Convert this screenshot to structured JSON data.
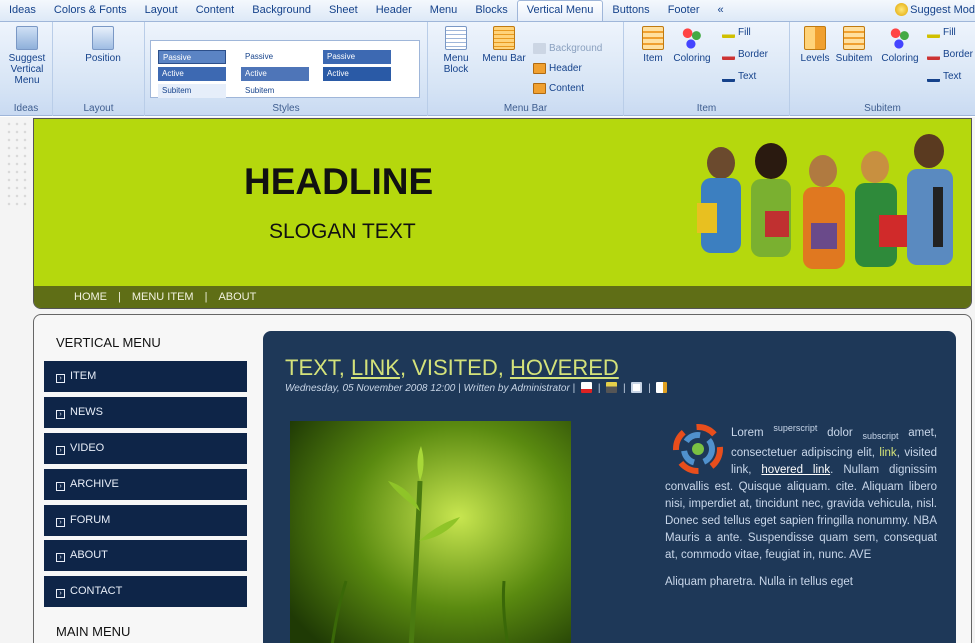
{
  "ribbon": {
    "tabs": [
      "Ideas",
      "Colors & Fonts",
      "Layout",
      "Content",
      "Background",
      "Sheet",
      "Header",
      "Menu",
      "Blocks",
      "Vertical Menu",
      "Buttons",
      "Footer",
      "«"
    ],
    "active_tab": "Vertical Menu",
    "suggest_top": "Suggest Mod",
    "groups": {
      "ideas": {
        "label": "Ideas",
        "button": "Suggest Vertical Menu"
      },
      "layout": {
        "label": "Layout",
        "button": "Position"
      },
      "styles": {
        "label": "Styles",
        "passive": "Passive",
        "active": "Active",
        "subitem": "Subitem"
      },
      "menubar": {
        "label": "Menu Bar",
        "menu_block": "Menu Block",
        "menu_bar": "Menu Bar",
        "background": "Background",
        "header": "Header",
        "content": "Content"
      },
      "item": {
        "label": "Item",
        "item": "Item",
        "coloring": "Coloring",
        "fill": "Fill",
        "border": "Border",
        "text": "Text"
      },
      "subitem": {
        "label": "Subitem",
        "levels": "Levels",
        "subitem": "Subitem",
        "coloring": "Coloring",
        "fill": "Fill",
        "border": "Border",
        "text": "Text"
      }
    }
  },
  "header": {
    "headline": "HEADLINE",
    "slogan": "SLOGAN TEXT",
    "nav": [
      "HOME",
      "|",
      "MENU ITEM",
      "|",
      "ABOUT"
    ]
  },
  "sidebar": {
    "title": "VERTICAL MENU",
    "items": [
      "ITEM",
      "NEWS",
      "VIDEO",
      "ARCHIVE",
      "FORUM",
      "ABOUT",
      "CONTACT"
    ],
    "main_menu_title": "MAIN MENU"
  },
  "article": {
    "title_text": "TEXT, ",
    "title_link": "LINK",
    "title_visited": ", VISITED, ",
    "title_hovered": "HOVERED",
    "meta": "Wednesday, 05 November 2008 12:00 | Written by Administrator |",
    "p1_a": "Lorem ",
    "p1_sup": "superscript",
    "p1_b": " dolor ",
    "p1_sub": "subscript",
    "p1_c": " amet, consectetuer adipiscing elit, ",
    "p1_link": "link",
    "p1_d": ", visited link, ",
    "p1_hover": "hovered link",
    "p1_e": ". Nullam dignissim convallis est. Quisque aliquam. cite. Aliquam libero nisi, imperdiet at, tincidunt nec, gravida vehicula, nisl. Donec sed tellus eget sapien fringilla nonummy. NBA Mauris a ante. Suspendisse quam sem, consequat at, commodo vitae, feugiat in, nunc. AVE",
    "p2": "Aliquam pharetra. Nulla in tellus eget"
  },
  "colors": {
    "header_bg": "#b5d80d",
    "nav_bg": "#5f6e16",
    "menu_item_bg": "#0e2548",
    "article_bg": "#1e3858",
    "link": "#d4e27a"
  }
}
